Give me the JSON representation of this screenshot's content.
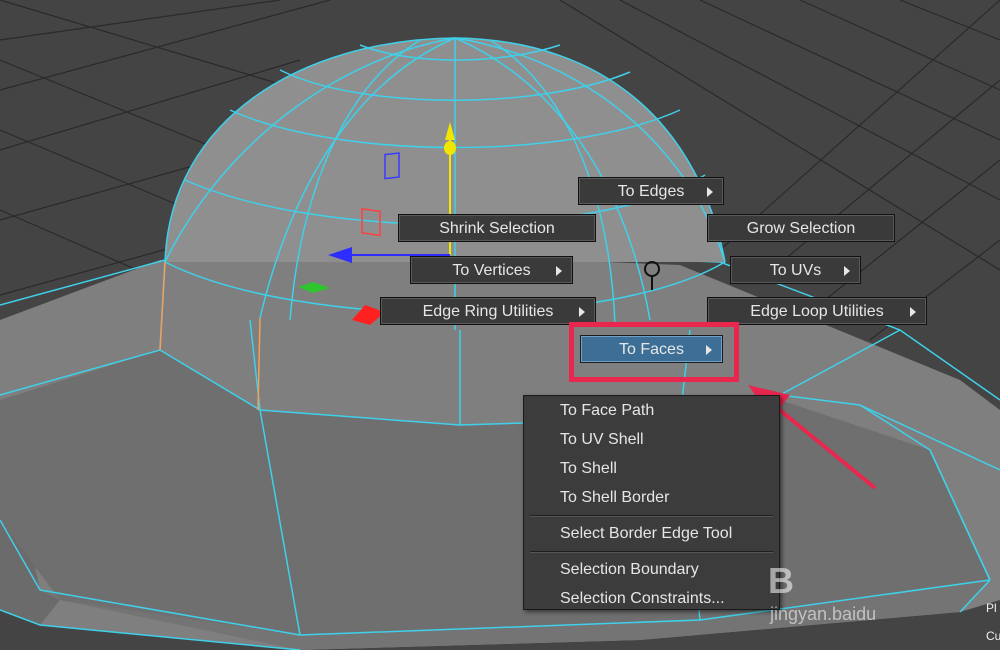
{
  "marking_menu": {
    "to_edges": "To Edges",
    "shrink_selection": "Shrink Selection",
    "grow_selection": "Grow Selection",
    "to_vertices": "To Vertices",
    "to_uvs": "To UVs",
    "edge_ring_utilities": "Edge Ring Utilities",
    "edge_loop_utilities": "Edge Loop Utilities",
    "to_faces": "To Faces"
  },
  "submenu": {
    "items": [
      "To Face Path",
      "To UV Shell",
      "To Shell",
      "To Shell Border",
      "Select Border Edge Tool",
      "Selection Boundary",
      "Selection Constraints..."
    ]
  },
  "watermark": {
    "logo": "B",
    "text": "jingyan.baidu"
  },
  "corner": {
    "line1": "Pl",
    "line2": "Cu"
  },
  "colors": {
    "accent_blue": "#3d6f96",
    "highlight_red": "#e8264e",
    "wire_cyan": "#3fd0ea",
    "mesh_gray": "#8f8f8f"
  }
}
